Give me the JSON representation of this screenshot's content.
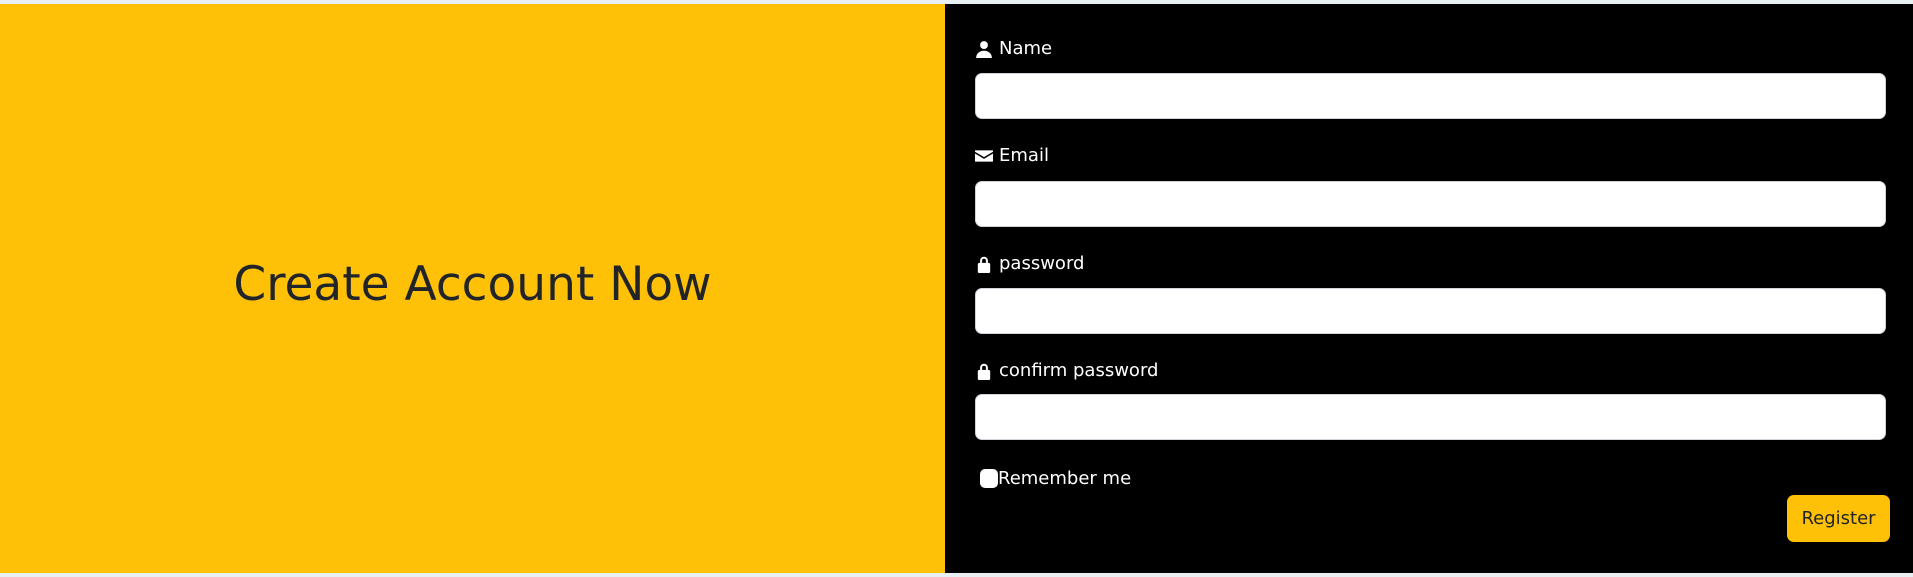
{
  "hero": {
    "title": "Create Account Now"
  },
  "form": {
    "fields": [
      {
        "label": "Name",
        "icon": "user-icon",
        "value": ""
      },
      {
        "label": "Email",
        "icon": "envelope-icon",
        "value": ""
      },
      {
        "label": "password",
        "icon": "lock-icon",
        "value": ""
      },
      {
        "label": "confirm password",
        "icon": "lock-icon",
        "value": ""
      }
    ],
    "remember_label": "Remember me",
    "submit_label": "Register"
  },
  "colors": {
    "accent": "#ffc107",
    "panel": "#000000",
    "text_dark": "#212529"
  }
}
